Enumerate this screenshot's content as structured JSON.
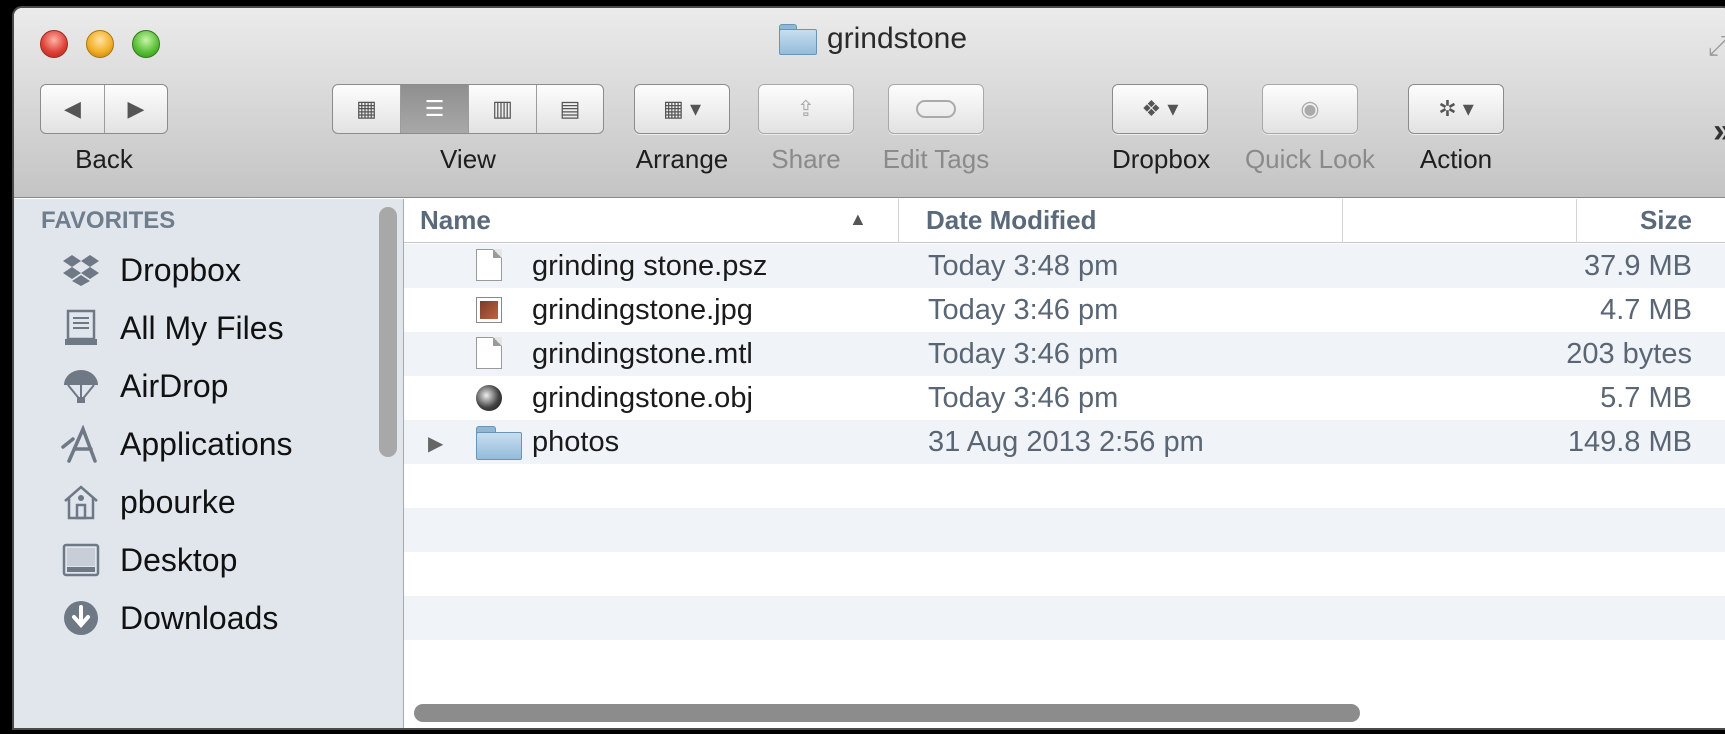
{
  "window": {
    "title": "grindstone"
  },
  "toolbar": {
    "back_label": "Back",
    "view_label": "View",
    "arrange_label": "Arrange",
    "share_label": "Share",
    "edit_tags_label": "Edit Tags",
    "dropbox_label": "Dropbox",
    "quick_look_label": "Quick Look",
    "action_label": "Action",
    "more_glyph": "»"
  },
  "sidebar": {
    "heading": "FAVORITES",
    "items": [
      {
        "label": "Dropbox",
        "icon": "dropbox-icon"
      },
      {
        "label": "All My Files",
        "icon": "all-my-files-icon"
      },
      {
        "label": "AirDrop",
        "icon": "airdrop-icon"
      },
      {
        "label": "Applications",
        "icon": "applications-icon"
      },
      {
        "label": "pbourke",
        "icon": "home-icon"
      },
      {
        "label": "Desktop",
        "icon": "desktop-icon"
      },
      {
        "label": "Downloads",
        "icon": "downloads-icon"
      }
    ]
  },
  "filelist": {
    "columns": {
      "name": "Name",
      "date": "Date Modified",
      "size": "Size"
    },
    "sort": {
      "column": "name",
      "direction": "ascending"
    },
    "rows": [
      {
        "name": "grinding stone.psz",
        "date": "Today 3:48 pm",
        "size": "37.9 MB",
        "icon": "document-icon"
      },
      {
        "name": "grindingstone.jpg",
        "date": "Today 3:46 pm",
        "size": "4.7 MB",
        "icon": "image-icon"
      },
      {
        "name": "grindingstone.mtl",
        "date": "Today 3:46 pm",
        "size": "203 bytes",
        "icon": "document-icon"
      },
      {
        "name": "grindingstone.obj",
        "date": "Today 3:46 pm",
        "size": "5.7 MB",
        "icon": "obj-file-icon"
      },
      {
        "name": "photos",
        "date": "31 Aug 2013 2:56 pm",
        "size": "149.8 MB",
        "icon": "folder-icon"
      }
    ]
  },
  "colors": {
    "sidebar_bg": "#e1e6ed",
    "row_alt": "#f0f3f7",
    "header_text": "#5a6a7a"
  }
}
